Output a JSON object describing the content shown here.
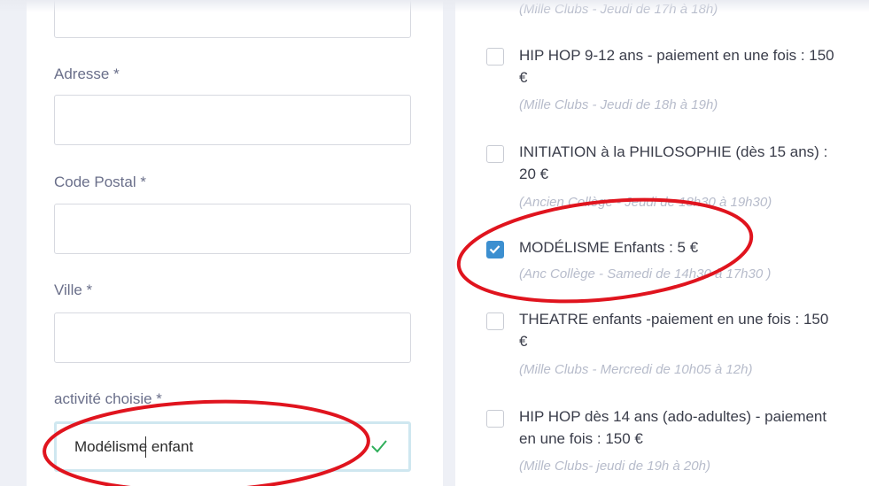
{
  "form": {
    "fields": [
      {
        "label": "Adresse *",
        "value": ""
      },
      {
        "label": "Code Postal *",
        "value": ""
      },
      {
        "label": "Ville *",
        "value": ""
      },
      {
        "label": "activité choisie *",
        "value": "Modélisme enfant"
      }
    ]
  },
  "activities": [
    {
      "title": "",
      "subtitle": "(Mille Clubs - Jeudi de 17h à 18h)",
      "checked": false
    },
    {
      "title": "HIP HOP 9-12 ans - paiement en une fois : 150 €",
      "subtitle": "(Mille Clubs - Jeudi de 18h à 19h)",
      "checked": false
    },
    {
      "title": "INITIATION à la PHILOSOPHIE (dès 15 ans) : 20 €",
      "subtitle": "(Ancien Collège - Jeudi de 18h30 à 19h30)",
      "checked": false
    },
    {
      "title": "MODÉLISME Enfants : 5 €",
      "subtitle": "(Anc Collège - Samedi de 14h30 à 17h30 )",
      "checked": true
    },
    {
      "title": "THEATRE enfants -paiement en une fois : 150 €",
      "subtitle": "(Mille Clubs - Mercredi de 10h05 à 12h)",
      "checked": false
    },
    {
      "title": "HIP HOP dès 14 ans (ado-adultes) - paiement en une fois : 150 €",
      "subtitle": "(Mille Clubs- jeudi de 19h à 20h)",
      "checked": false
    }
  ],
  "colors": {
    "accent": "#3c8fd0",
    "annotation": "#e0141e",
    "valid": "#2fae5a"
  }
}
